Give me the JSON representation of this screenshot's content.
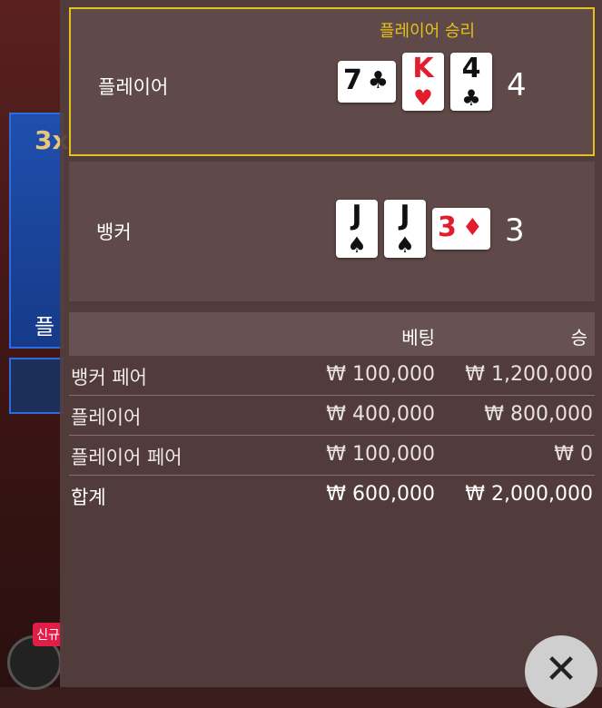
{
  "background": {
    "multiplier": "3x",
    "panel_text": "플",
    "new_badge": "신규"
  },
  "result": {
    "winner_text": "플레이어 승리",
    "player": {
      "label": "플레이어",
      "cards": [
        {
          "rank": "7",
          "suit": "♣",
          "color": "black",
          "sideways": true
        },
        {
          "rank": "K",
          "suit": "♥",
          "color": "red",
          "sideways": false
        },
        {
          "rank": "4",
          "suit": "♣",
          "color": "black",
          "sideways": false
        }
      ],
      "score": "4"
    },
    "banker": {
      "label": "뱅커",
      "cards": [
        {
          "rank": "J",
          "suit": "♠",
          "color": "black",
          "sideways": false
        },
        {
          "rank": "J",
          "suit": "♠",
          "color": "black",
          "sideways": false
        },
        {
          "rank": "3",
          "suit": "♦",
          "color": "red",
          "sideways": true
        }
      ],
      "score": "3"
    }
  },
  "bets": {
    "header_bet": "베팅",
    "header_win": "승",
    "rows": [
      {
        "name": "뱅커 페어",
        "bet": "₩ 100,000",
        "win": "₩ 1,200,000"
      },
      {
        "name": "플레이어",
        "bet": "₩ 400,000",
        "win": "₩ 800,000"
      },
      {
        "name": "플레이어 페어",
        "bet": "₩ 100,000",
        "win": "₩ 0"
      }
    ],
    "total": {
      "name": "합계",
      "bet": "₩ 600,000",
      "win": "₩ 2,000,000"
    }
  },
  "close_icon": "close-icon",
  "colors": {
    "winner_border": "#e3c21a",
    "red_suit": "#e11d2e"
  }
}
